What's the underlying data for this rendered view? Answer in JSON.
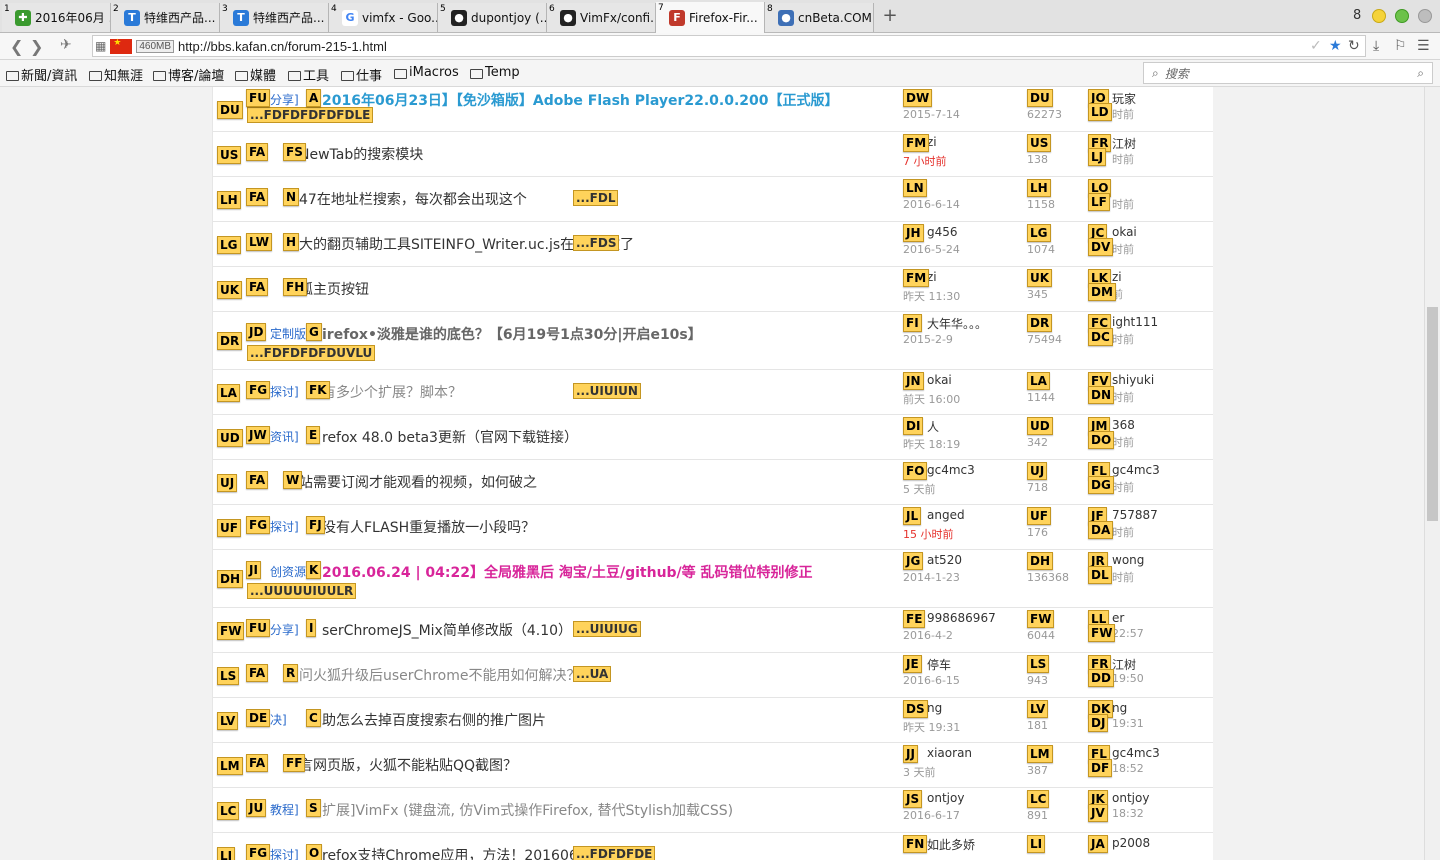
{
  "tabs": [
    {
      "num": "1",
      "label": "2016年06月 ...",
      "icon": "puzzle-icon",
      "color": "#3a9a2e"
    },
    {
      "num": "2",
      "label": "特维西产品...",
      "icon": "t-icon",
      "color": "#2a7ad8"
    },
    {
      "num": "3",
      "label": "特维西产品...",
      "icon": "t-icon",
      "color": "#2a7ad8"
    },
    {
      "num": "4",
      "label": "vimfx - Goo...",
      "icon": "google-icon",
      "color": "#4285f4"
    },
    {
      "num": "5",
      "label": "dupontjoy (...",
      "icon": "github-icon",
      "color": "#222222"
    },
    {
      "num": "6",
      "label": "VimFx/confi...",
      "icon": "github-icon",
      "color": "#222222"
    },
    {
      "num": "7",
      "label": "Firefox-Fir...",
      "icon": "ff-icon",
      "color": "#c0392b"
    },
    {
      "num": "8",
      "label": "cnBeta.COM...",
      "icon": "cnbeta-icon",
      "color": "#3d6fb6"
    }
  ],
  "new_tab": "+",
  "tab_count": "8",
  "url": "http://bbs.kafan.cn/forum-215-1.html",
  "memory": "460MB",
  "bookmarks": [
    "新聞/資訊",
    "知無涯",
    "博客/論壇",
    "媒體",
    "工具",
    "仕事",
    "iMacros",
    "Temp"
  ],
  "search_placeholder": "搜索",
  "rows": [
    {
      "h1": "DU",
      "h2": "FU",
      "cat": "分享]",
      "h3": "A",
      "title": "2016年06月23日】【免沙箱版】Adobe Flash Player22.0.0.200【正式版】",
      "tcolor": "#2a9ad1",
      "bold": true,
      "extras": "...FDFDFDFDFDLE",
      "author_hint": "DW",
      "author": "t",
      "date": "2015-7-14",
      "rep_hint": "DU",
      "replies": "62273",
      "last_hint1": "JO",
      "last_hint2": "LD",
      "last_user": "玩家",
      "last_time": "时前"
    },
    {
      "h1": "US",
      "h2": "FA",
      "cat": "",
      "h3": "FS",
      "title": "NewTab的搜索模块",
      "tcolor": "#333",
      "bold": false,
      "extras": "",
      "author_hint": "FM",
      "author": "zi",
      "date": "7 小时前",
      "rep_hint": "US",
      "replies": "138",
      "last_hint1": "FR",
      "last_hint2": "LJ",
      "last_user": "江树",
      "last_time": "时前"
    },
    {
      "h1": "LH",
      "h2": "FA",
      "cat": "",
      "h3": "N",
      "title": "47在地址栏搜索，每次都会出现这个",
      "tcolor": "#333",
      "bold": false,
      "extras": "...FDL",
      "author_hint": "LN",
      "author": "",
      "date": "2016-6-14",
      "rep_hint": "LH",
      "replies": "1158",
      "last_hint1": "LO",
      "last_hint2": "LF",
      "last_user": "",
      "last_time": "时前"
    },
    {
      "h1": "LG",
      "h2": "LW",
      "cat": "",
      "h3": "H",
      "title": "大的翻页辅助工具SITEINFO_Writer.uc.js在46失效了",
      "tcolor": "#333",
      "bold": false,
      "extras": "...FDS",
      "author_hint": "JH",
      "author": "g456",
      "date": "2016-5-24",
      "rep_hint": "LG",
      "replies": "1074",
      "last_hint1": "JC",
      "last_hint2": "DV",
      "last_user": "okai",
      "last_time": "时前"
    },
    {
      "h1": "UK",
      "h2": "FA",
      "cat": "",
      "h3": "FH",
      "title": "狐主页按钮",
      "tcolor": "#333",
      "bold": false,
      "extras": "",
      "author_hint": "FM",
      "author": "zi",
      "date": "昨天 11:30",
      "rep_hint": "UK",
      "replies": "345",
      "last_hint1": "LK",
      "last_hint2": "DM",
      "last_user": "zi",
      "last_time": "前"
    },
    {
      "h1": "DR",
      "h2": "JD",
      "cat": "定制版]",
      "h3": "G",
      "title": "irefox•淡雅是谁的底色？【6月19号1点30分|开启e10s】",
      "tcolor": "#666",
      "bold": true,
      "extras": "...FDFDFDFDUVLU",
      "author_hint": "FI",
      "author": "大年华。。。",
      "date": "2015-2-9",
      "rep_hint": "DR",
      "replies": "75494",
      "last_hint1": "FC",
      "last_hint2": "DC",
      "last_user": "ight111",
      "last_time": "时前"
    },
    {
      "h1": "LA",
      "h2": "FG",
      "cat": "探讨]",
      "h3": "FK",
      "title": "有多少个扩展？脚本？",
      "tcolor": "#888",
      "bold": false,
      "extras": "...UIUIUN",
      "author_hint": "JN",
      "author": "okai",
      "date": "前天 16:00",
      "rep_hint": "LA",
      "replies": "1144",
      "last_hint1": "FV",
      "last_hint2": "DN",
      "last_user": "shiyuki",
      "last_time": "时前"
    },
    {
      "h1": "UD",
      "h2": "JW",
      "cat": "资讯]",
      "h3": "E",
      "title": "refox 48.0 beta3更新（官网下载链接）",
      "tcolor": "#333",
      "bold": false,
      "extras": "",
      "author_hint": "DI",
      "author": "人",
      "date": "昨天 18:19",
      "rep_hint": "UD",
      "replies": "342",
      "last_hint1": "JM",
      "last_hint2": "DO",
      "last_user": "368",
      "last_time": "时前"
    },
    {
      "h1": "UJ",
      "h2": "FA",
      "cat": "",
      "h3": "W",
      "title": "站需要订阅才能观看的视频，如何破之",
      "tcolor": "#333",
      "bold": false,
      "extras": "",
      "author_hint": "FO",
      "author": "gc4mc3",
      "date": "5 天前",
      "rep_hint": "UJ",
      "replies": "718",
      "last_hint1": "FL",
      "last_hint2": "DG",
      "last_user": "gc4mc3",
      "last_time": "时前"
    },
    {
      "h1": "UF",
      "h2": "FG",
      "cat": "探讨]",
      "h3": "FJ",
      "title": "没有人FLASH重复播放一小段吗？",
      "tcolor": "#333",
      "bold": false,
      "extras": "",
      "author_hint": "JL",
      "author": "anged",
      "date": "15 小时前",
      "rep_hint": "UF",
      "replies": "176",
      "last_hint1": "JF",
      "last_hint2": "DA",
      "last_user": "757887",
      "last_time": "时前"
    },
    {
      "h1": "DH",
      "h2": "JI",
      "cat": "创资源]",
      "h3": "K",
      "title": "2016.06.24 | 04:22】全局雅黑后 淘宝/土豆/github/等 乱码错位特别修正",
      "tcolor": "#d8259a",
      "bold": true,
      "extras": "...UUUUUIUULR",
      "author_hint": "JG",
      "author": "at520",
      "date": "2014-1-23",
      "rep_hint": "DH",
      "replies": "136368",
      "last_hint1": "JR",
      "last_hint2": "DL",
      "last_user": "wong",
      "last_time": "时前"
    },
    {
      "h1": "FW",
      "h2": "FU",
      "cat": "分享]",
      "h3": "I",
      "title": "serChromeJS_Mix简单修改版（4.10）",
      "tcolor": "#333",
      "bold": false,
      "extras": "...UIUIUG",
      "author_hint": "FE",
      "author": "998686967",
      "date": "2016-4-2",
      "rep_hint": "FW",
      "replies": "6044",
      "last_hint1": "LL",
      "last_hint2": "FW",
      "last_user": "er",
      "last_time": "22:57"
    },
    {
      "h1": "LS",
      "h2": "FA",
      "cat": "",
      "h3": "R",
      "title": "问火狐升级后userChrome不能用如何解决？",
      "tcolor": "#888",
      "bold": false,
      "extras": "...UA",
      "author_hint": "JE",
      "author": "停车",
      "date": "2016-6-15",
      "rep_hint": "LS",
      "replies": "943",
      "last_hint1": "FR",
      "last_hint2": "DD",
      "last_user": "江树",
      "last_time": "19:50"
    },
    {
      "h1": "LV",
      "h2": "DE",
      "cat": "决]",
      "h3": "C",
      "title": "助怎么去掉百度搜索右侧的推广图片",
      "tcolor": "#333",
      "bold": false,
      "extras": "",
      "author_hint": "DS",
      "author": "ng",
      "date": "昨天 19:31",
      "rep_hint": "LV",
      "replies": "181",
      "last_hint1": "DK",
      "last_hint2": "DJ",
      "last_user": "ng",
      "last_time": "19:31"
    },
    {
      "h1": "LM",
      "h2": "FA",
      "cat": "",
      "h3": "FF",
      "title": "言网页版，火狐不能粘贴QQ截图？",
      "tcolor": "#333",
      "bold": false,
      "extras": "",
      "author_hint": "JJ",
      "author": "xiaoran",
      "date": "3 天前",
      "rep_hint": "LM",
      "replies": "387",
      "last_hint1": "FL",
      "last_hint2": "DF",
      "last_user": "gc4mc3",
      "last_time": "18:52"
    },
    {
      "h1": "LC",
      "h2": "JU",
      "cat": "教程]",
      "h3": "S",
      "title": "扩展]VimFx (键盘流, 仿Vim式操作Firefox, 替代Stylish加载CSS)",
      "tcolor": "#888",
      "bold": false,
      "extras": "",
      "author_hint": "JS",
      "author": "ontjoy",
      "date": "2016-6-17",
      "rep_hint": "LC",
      "replies": "891",
      "last_hint1": "JK",
      "last_hint2": "JV",
      "last_user": "ontjoy",
      "last_time": "18:32"
    },
    {
      "h1": "LI",
      "h2": "FG",
      "cat": "探讨]",
      "h3": "O",
      "title": "refox支持Chrome应用，方法！20160621更新",
      "tcolor": "#333",
      "bold": false,
      "extras": "...FDFDFDE",
      "author_hint": "FN",
      "author": "如此多娇",
      "date": "",
      "rep_hint": "LI",
      "replies": "",
      "last_hint1": "JA",
      "last_hint2": "",
      "last_user": "p2008",
      "last_time": ""
    }
  ]
}
